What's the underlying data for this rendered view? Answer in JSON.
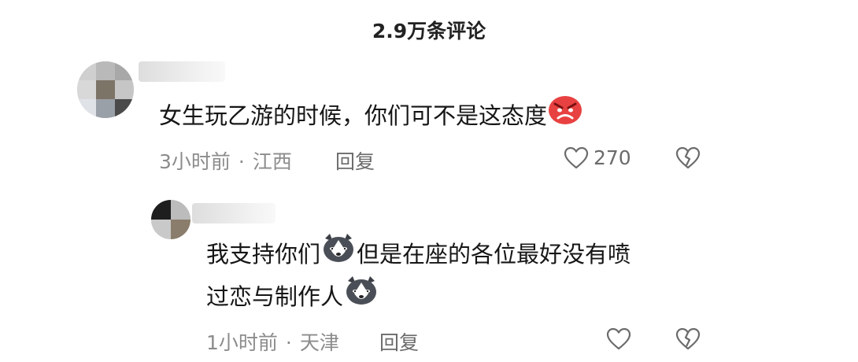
{
  "header": {
    "title": "2.9万条评论"
  },
  "comments": [
    {
      "text": "女生玩乙游的时候，你们可不是这态度",
      "emoji": "angry-face-icon",
      "time": "3小时前",
      "location": "江西",
      "reply_label": "回复",
      "like_count": "270"
    },
    {
      "text_line1": "我支持你们",
      "text_line1b": "但是在座的各位最好没有喷",
      "text_line2": "过恋与制作人",
      "emoji": "husky-dog-face-icon",
      "time": "1小时前",
      "location": "天津",
      "reply_label": "回复"
    }
  ],
  "colors": {
    "text": "#161616",
    "meta": "#8c8c8c",
    "icon": "#6b6b6b",
    "angry_emoji": "#e84141"
  },
  "separator": "·"
}
